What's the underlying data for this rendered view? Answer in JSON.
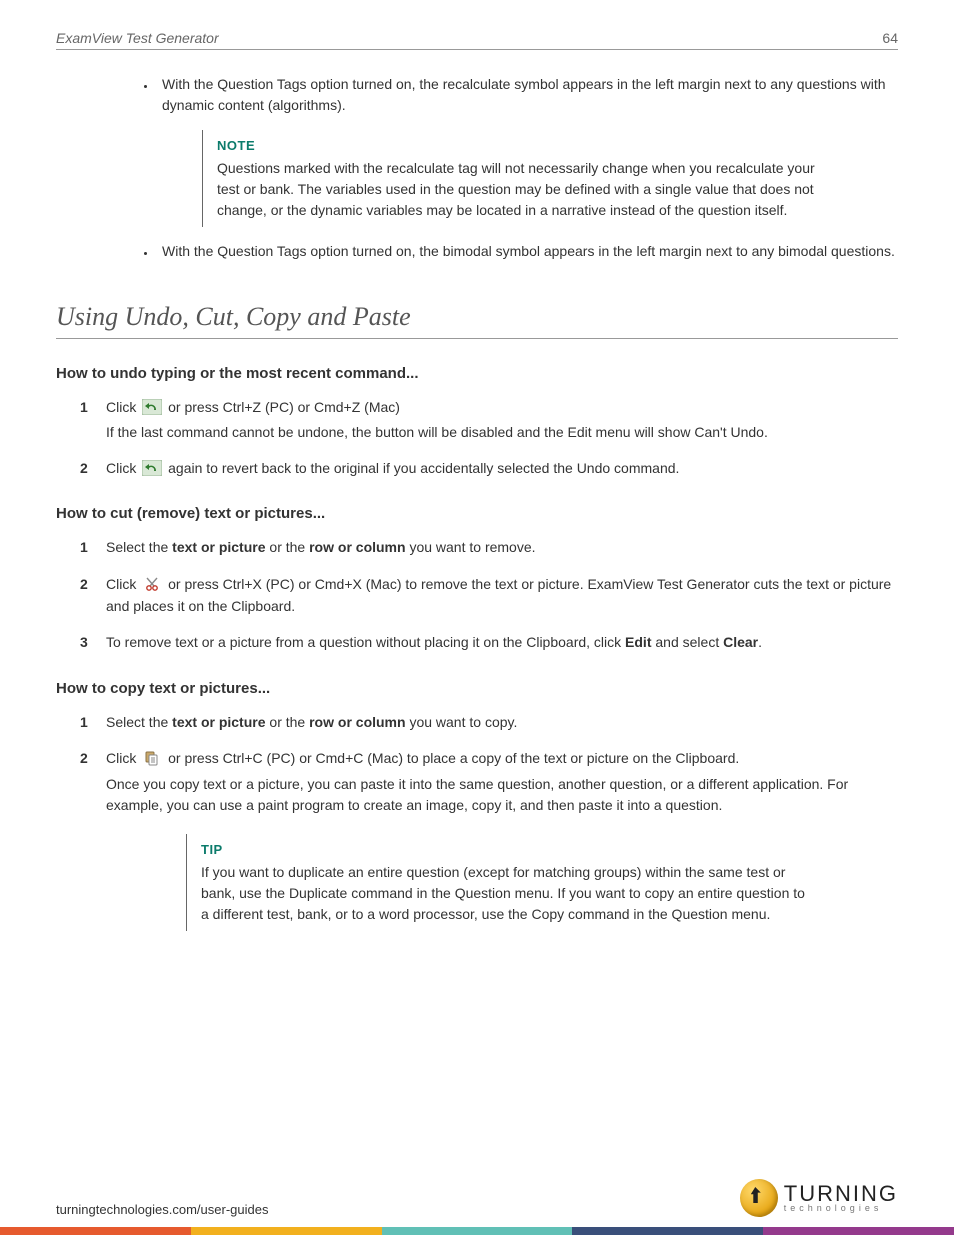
{
  "header": {
    "title": "ExamView Test Generator",
    "page_number": "64"
  },
  "bullets": {
    "b1": "With the Question Tags option turned on, the recalculate symbol appears in the left margin next to any questions with dynamic content (algorithms).",
    "b2": "With the Question Tags option turned on, the bimodal symbol appears in the left margin next to any bimodal questions."
  },
  "note": {
    "title": "NOTE",
    "body": "Questions marked with the recalculate tag will not necessarily change when you recalculate your test or bank. The variables used in the question may be defined with a single value that does not change, or the dynamic variables may be located in a narrative instead of the question itself."
  },
  "section_heading": "Using Undo, Cut, Copy and Paste",
  "undo": {
    "heading": "How to undo typing or the most recent command...",
    "step1_a": "Click ",
    "step1_b": " or press Ctrl+Z (PC) or Cmd+Z (Mac)",
    "step1_extra": "If the last command cannot be undone, the button will be disabled and the Edit menu will show Can't Undo.",
    "step2_a": "Click ",
    "step2_b": " again to revert back to the original if you accidentally selected the Undo command."
  },
  "cut": {
    "heading": "How to cut (remove) text or pictures...",
    "step1_a": "Select the ",
    "step1_bold1": "text or picture",
    "step1_b": " or the ",
    "step1_bold2": "row or column",
    "step1_c": " you want to remove.",
    "step2_a": "Click ",
    "step2_b": " or press Ctrl+X (PC) or Cmd+X (Mac) to remove the text or picture. ExamView Test Generator cuts the text or picture and places it on the Clipboard.",
    "step3_a": "To remove text or a picture from a question without placing it on the Clipboard, click ",
    "step3_bold1": "Edit",
    "step3_b": " and select ",
    "step3_bold2": "Clear",
    "step3_c": "."
  },
  "copy": {
    "heading": "How to copy text or pictures...",
    "step1_a": "Select the ",
    "step1_bold1": "text or picture",
    "step1_b": " or the ",
    "step1_bold2": "row or column",
    "step1_c": " you want to copy.",
    "step2_a": "Click ",
    "step2_b": " or press Ctrl+C (PC) or Cmd+C (Mac) to place a copy of the text or picture on the Clipboard.",
    "step2_extra": "Once you copy text or a picture, you can paste it into the same question, another question, or a different application. For example, you can use a paint program to create an image, copy it, and then paste it into a question."
  },
  "tip": {
    "title": "TIP",
    "body": "If you want to duplicate an entire question (except for matching groups) within the same test or bank, use the Duplicate command in the Question menu. If you want to copy an entire question to a different test, bank, or to a word processor, use the Copy command in the Question menu."
  },
  "footer": {
    "url": "turningtechnologies.com/user-guides",
    "logo_main": "TURNING",
    "logo_sub": "technologies"
  },
  "nums": {
    "one": "1",
    "two": "2",
    "three": "3"
  }
}
